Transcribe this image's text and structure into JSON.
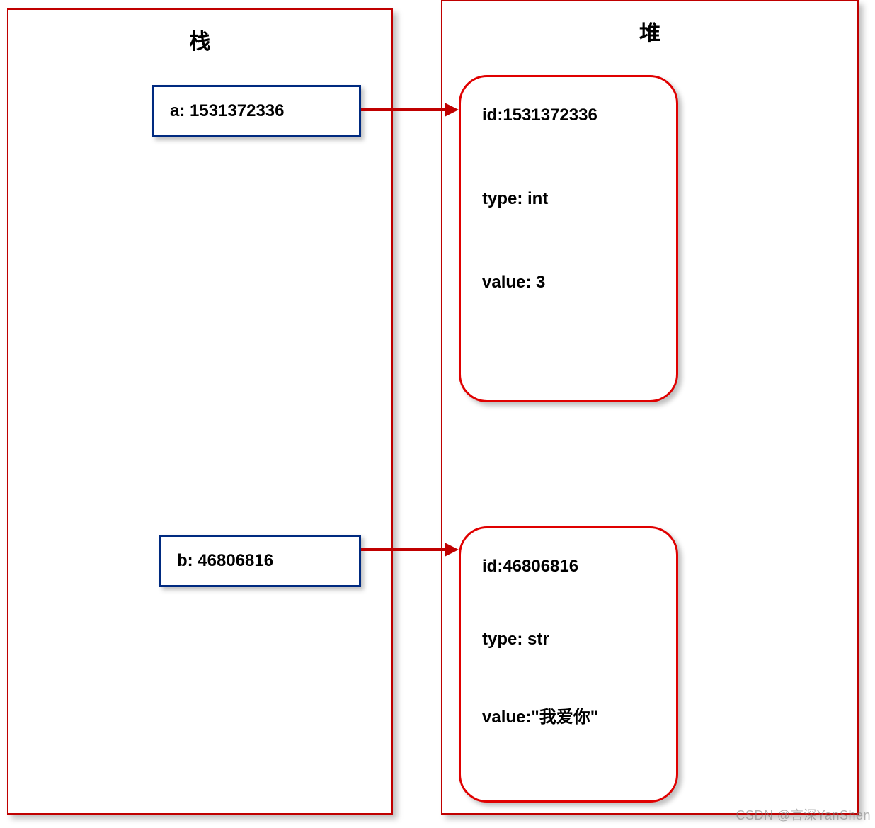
{
  "stack": {
    "title": "栈",
    "a_label": "a: 1531372336",
    "b_label": "b: 46806816"
  },
  "heap": {
    "title": "堆",
    "obj_a": {
      "id_line": "id:1531372336",
      "type_line": "type: int",
      "value_line": "value:  3"
    },
    "obj_b": {
      "id_line": "id:46806816",
      "type_line": "type: str",
      "value_line": "value:\"我爱你\""
    }
  },
  "watermark": "CSDN @言深YanShen"
}
